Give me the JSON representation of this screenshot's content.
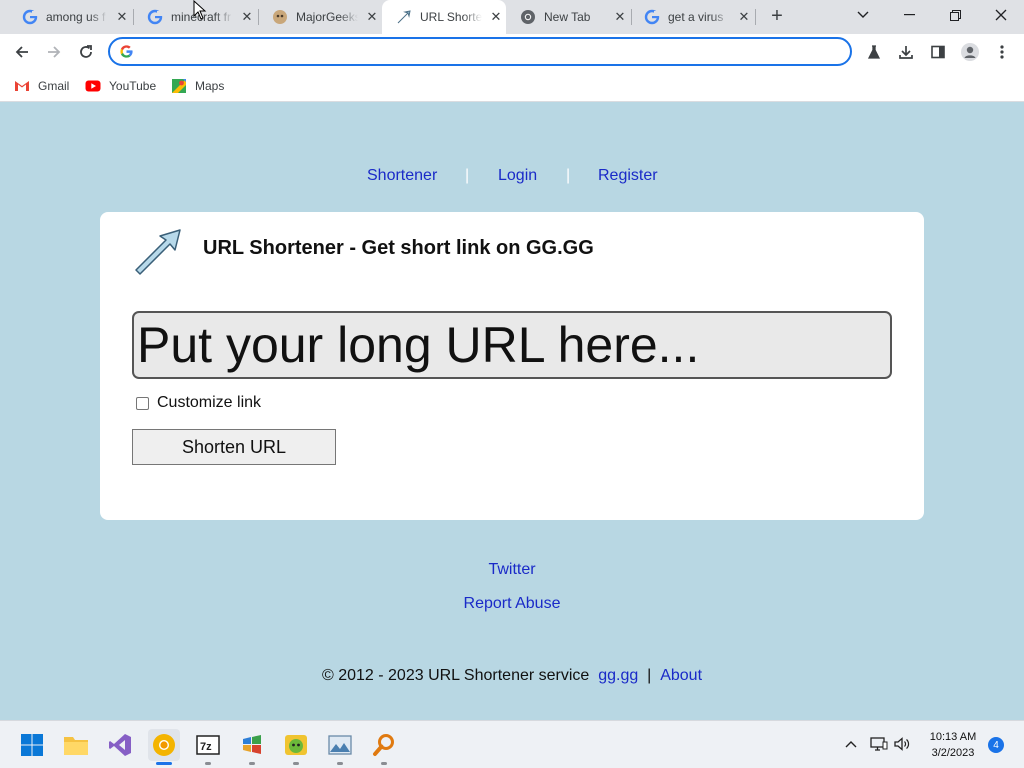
{
  "browser": {
    "tabs": [
      {
        "title": "among us f",
        "favicon": "google-icon",
        "active": false
      },
      {
        "title": "minecraft fr",
        "favicon": "google-icon",
        "active": false
      },
      {
        "title": "MajorGeeks",
        "favicon": "majorgeeks-icon",
        "active": false
      },
      {
        "title": "URL Shorte",
        "favicon": "url-shortener-icon",
        "active": true
      },
      {
        "title": "New Tab",
        "favicon": "chrome-icon",
        "active": false
      },
      {
        "title": "get a virus",
        "favicon": "google-icon",
        "active": false
      }
    ],
    "omnibox": {
      "value": "",
      "placeholder": ""
    },
    "bookmarks": [
      {
        "label": "Gmail",
        "icon": "gmail-icon"
      },
      {
        "label": "YouTube",
        "icon": "youtube-icon"
      },
      {
        "label": "Maps",
        "icon": "maps-icon"
      }
    ]
  },
  "site": {
    "nav": {
      "shortener": "Shortener",
      "separator": "|",
      "login": "Login",
      "register": "Register"
    },
    "title": "URL Shortener - Get short link on GG.GG",
    "url_placeholder": "Put your long URL here...",
    "customize_label": "Customize link",
    "customize_checked": false,
    "submit_label": "Shorten URL",
    "footer": {
      "twitter": "Twitter",
      "report": "Report Abuse",
      "copyright": "© 2012 - 2023 URL Shortener service",
      "gg_link": "gg.gg",
      "separator": "|",
      "about": "About"
    }
  },
  "taskbar": {
    "apps": [
      "windows-start-icon",
      "file-explorer-icon",
      "visual-studio-icon",
      "chrome-canary-icon",
      "7zip-icon",
      "windows-app-icon",
      "game-app-icon",
      "image-viewer-icon",
      "search-tool-icon"
    ],
    "time": "10:13 AM",
    "date": "3/2/2023",
    "notification_count": "4"
  },
  "colors": {
    "page_background": "#b8d7e3",
    "link": "#1a2ac8",
    "chrome_accent": "#1a73e8"
  }
}
